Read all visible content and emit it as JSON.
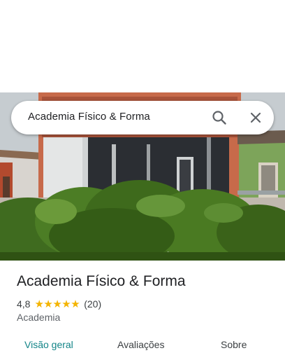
{
  "search": {
    "query": "Academia Físico & Forma",
    "search_icon": "search-icon",
    "close_icon": "close-icon"
  },
  "photo": {
    "kind": "street-view-image"
  },
  "place": {
    "title": "Academia Físico & Forma",
    "rating": "4,8",
    "stars": "★★★★★",
    "stars_value": 4.8,
    "review_count": "(20)",
    "category": "Academia"
  },
  "tabs": [
    {
      "label": "Visão geral",
      "active": true
    },
    {
      "label": "Avaliações",
      "active": false
    },
    {
      "label": "Sobre",
      "active": false
    }
  ],
  "colors": {
    "active_tab": "#128487",
    "stars": "#f4b400",
    "text_primary": "#202124",
    "text_secondary": "#5f6368"
  }
}
